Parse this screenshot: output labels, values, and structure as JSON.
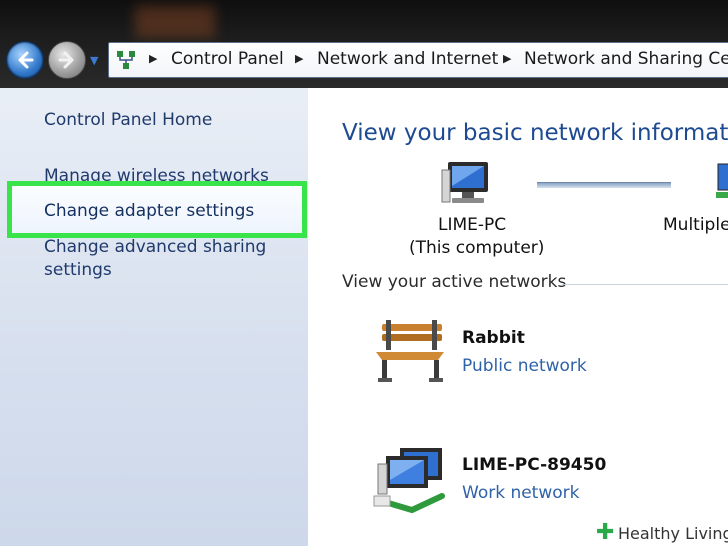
{
  "addressbar": {
    "crumbs": [
      "Control Panel",
      "Network and Internet",
      "Network and Sharing Cen"
    ]
  },
  "sidebar": {
    "home": "Control Panel Home",
    "items": [
      "Manage wireless networks",
      "Change adapter settings",
      "Change advanced sharing",
      "settings"
    ]
  },
  "main": {
    "title": "View your basic network information",
    "computer_name": "LIME-PC",
    "computer_sub": "(This computer)",
    "multiple": "Multiple",
    "active_label": "View your active networks",
    "networks": [
      {
        "name": "Rabbit",
        "type": "Public network",
        "icon": "bench-icon"
      },
      {
        "name": "LIME-PC-89450",
        "type": "Work network",
        "icon": "work-computers-icon"
      }
    ]
  },
  "watermark": {
    "text": "Healthy Living"
  },
  "colors": {
    "highlight": "#39e34a",
    "link": "#2f62a8",
    "title": "#1e4a92"
  }
}
